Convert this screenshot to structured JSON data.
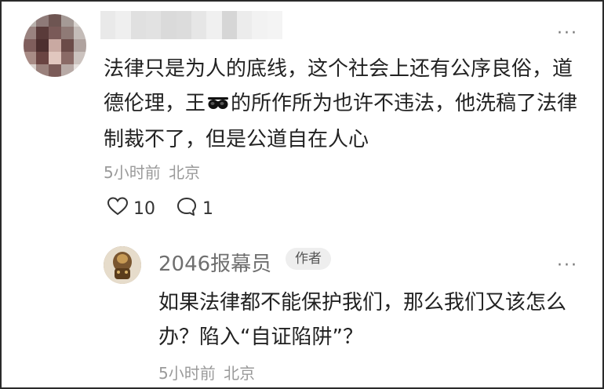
{
  "comment": {
    "more_label": "···",
    "text_before_emoji": "法律只是为人的底线，这个社会上还有公序良俗，道德伦理，王",
    "emoji_icon": "sunglasses-emoji-icon",
    "text_after_emoji": "的所作所为也许不违法，他洗稿了法律制裁不了，但是公道自在人心",
    "time": "5小时前",
    "location": "北京",
    "like_count": "10",
    "reply_count": "1"
  },
  "reply": {
    "author": "2046报幕员",
    "badge": "作者",
    "more_label": "···",
    "text": "如果法律都不能保护我们，那么我们又该怎么办？陷入“自证陷阱”？",
    "time": "5小时前",
    "location": "北京"
  },
  "colors": {
    "text": "#222222",
    "meta": "#9a9a9a",
    "border": "#2a2a2a"
  }
}
